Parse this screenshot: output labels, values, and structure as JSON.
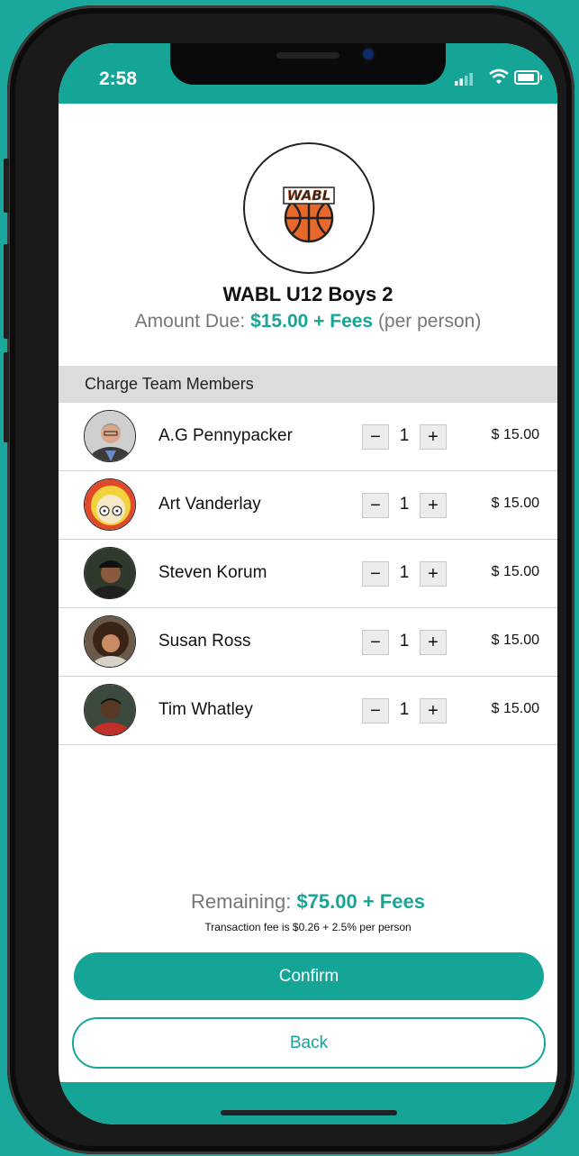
{
  "status": {
    "time": "2:58"
  },
  "team": {
    "name": "WABL U12 Boys 2",
    "amount_label": "Amount Due: ",
    "amount_value": "$15.00 + Fees",
    "amount_suffix": " (per person)",
    "logo_text": "WABL"
  },
  "section": {
    "title": "Charge Team Members"
  },
  "members": [
    {
      "name": "A.G Pennypacker",
      "qty": "1",
      "price": "$ 15.00"
    },
    {
      "name": "Art Vanderlay",
      "qty": "1",
      "price": "$ 15.00"
    },
    {
      "name": "Steven Korum",
      "qty": "1",
      "price": "$ 15.00"
    },
    {
      "name": "Susan Ross",
      "qty": "1",
      "price": "$ 15.00"
    },
    {
      "name": "Tim Whatley",
      "qty": "1",
      "price": "$ 15.00"
    }
  ],
  "stepper": {
    "minus": "−",
    "plus": "+"
  },
  "summary": {
    "remaining_label": "Remaining: ",
    "remaining_value": "$75.00 + Fees",
    "fee_note": "Transaction fee is $0.26 + 2.5% per person"
  },
  "actions": {
    "confirm": "Confirm",
    "back": "Back"
  },
  "colors": {
    "accent": "#15a597",
    "background": "#1aa89c"
  }
}
